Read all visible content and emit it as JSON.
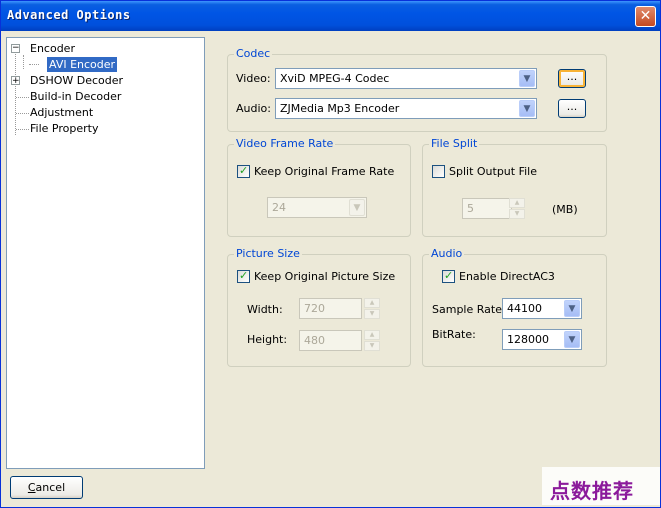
{
  "window": {
    "title": "Advanced Options",
    "close_glyph": "✕"
  },
  "tree": {
    "items": [
      {
        "label": "Encoder",
        "expander": "−"
      },
      {
        "label": "AVI Encoder",
        "selected": true
      },
      {
        "label": "DSHOW Decoder",
        "expander": "+"
      },
      {
        "label": "Build-in Decoder"
      },
      {
        "label": "Adjustment"
      },
      {
        "label": "File Property"
      }
    ]
  },
  "codec": {
    "title": "Codec",
    "video_label": "Video:",
    "video_value": "XviD MPEG-4 Codec",
    "audio_label": "Audio:",
    "audio_value": "ZJMedia Mp3 Encoder",
    "browse_label": "..."
  },
  "video_frame_rate": {
    "title": "Video Frame Rate",
    "keep_label": "Keep Original Frame Rate",
    "keep_checked": true,
    "rate_value": "24"
  },
  "file_split": {
    "title": "File Split",
    "split_label": "Split Output File",
    "split_checked": false,
    "size_value": "5",
    "unit": "(MB)"
  },
  "picture_size": {
    "title": "Picture Size",
    "keep_label": "Keep Original Picture Size",
    "keep_checked": true,
    "width_label": "Width:",
    "width_value": "720",
    "height_label": "Height:",
    "height_value": "480"
  },
  "audio": {
    "title": "Audio",
    "enable_label": "Enable DirectAC3",
    "enable_checked": true,
    "sample_rate_label": "Sample Rate:",
    "sample_rate_value": "44100",
    "bitrate_label": "BitRate:",
    "bitrate_value": "128000"
  },
  "footer": {
    "cancel_prefix": "",
    "cancel_underlined": "C",
    "cancel_rest": "ancel"
  },
  "watermark": {
    "text": "点数推荐"
  },
  "colors": {
    "accent": "#0046d5",
    "selection": "#316ac5",
    "titlebar": "#0055e5"
  },
  "icons": {
    "close": "close-icon",
    "dropdown": "chevron-down-icon",
    "spin_up": "spin-up-icon",
    "spin_down": "spin-down-icon"
  }
}
